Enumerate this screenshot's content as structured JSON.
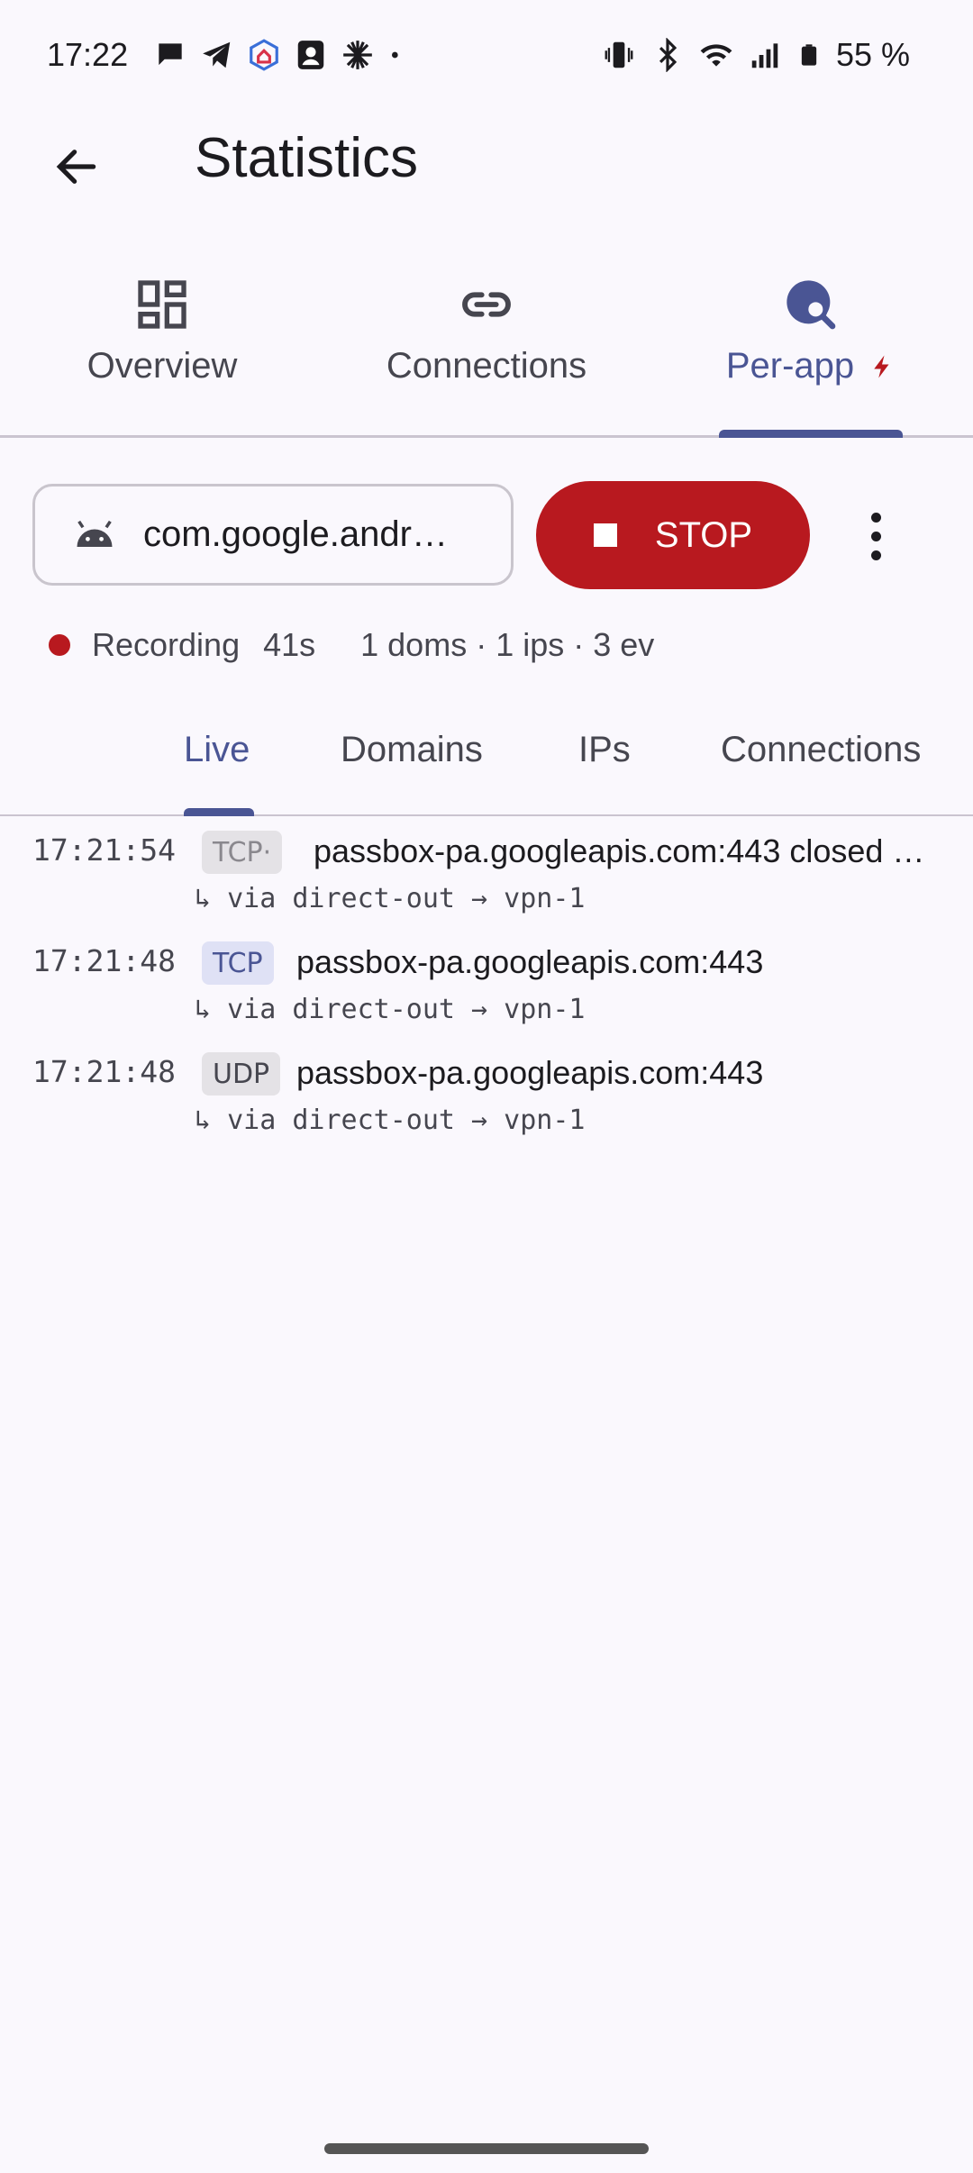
{
  "status_bar": {
    "time": "17:22",
    "battery": "55 %",
    "left_icons": [
      "chat-bubble-icon",
      "telegram-icon",
      "home-shield-icon",
      "contact-icon",
      "asterisk-icon",
      "dot-icon"
    ],
    "right_icons": [
      "vibrate-icon",
      "bluetooth-icon",
      "wifi-icon",
      "signal-icon",
      "battery-icon"
    ]
  },
  "app_bar": {
    "title": "Statistics"
  },
  "top_tabs": [
    {
      "label": "Overview",
      "icon": "dashboard-icon"
    },
    {
      "label": "Connections",
      "icon": "link-icon"
    },
    {
      "label": "Per-app",
      "icon": "globe-search-icon",
      "active": true,
      "badge_icon": "bolt-icon"
    }
  ],
  "app_selector": {
    "package": "com.google.andr…",
    "icon": "android-icon"
  },
  "stop_button": {
    "label": "STOP",
    "color": "#b8191f"
  },
  "recording": {
    "label": "Recording",
    "elapsed": "41s",
    "stats": "1 doms · 1 ips · 3 ev"
  },
  "sub_tabs": [
    {
      "label": "Live",
      "active": true
    },
    {
      "label": "Domains"
    },
    {
      "label": "IPs"
    },
    {
      "label": "Connections"
    }
  ],
  "events": [
    {
      "time": "17:21:54",
      "proto": "TCP·",
      "host": "passbox-pa.googleapis.com:443 closed …",
      "route": "↳ via direct-out → vpn-1"
    },
    {
      "time": "17:21:48",
      "proto": "TCP",
      "host": "passbox-pa.googleapis.com:443",
      "route": "↳ via direct-out → vpn-1"
    },
    {
      "time": "17:21:48",
      "proto": "UDP",
      "host": "passbox-pa.googleapis.com:443",
      "route": "↳ via direct-out → vpn-1"
    }
  ],
  "colors": {
    "accent": "#4a5594",
    "danger": "#b8191f",
    "background": "#faf8fd"
  }
}
